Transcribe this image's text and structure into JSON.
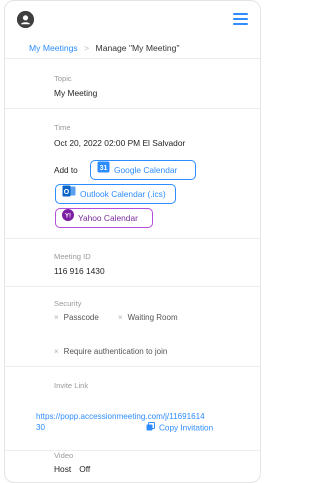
{
  "header": {
    "logo_icon": "user-circle-icon",
    "menu_icon": "hamburger-menu-icon",
    "accent": "#2d8cff"
  },
  "breadcrumb": {
    "parent": "My Meetings",
    "separator": ">",
    "current": "Manage \"My Meeting\""
  },
  "topic": {
    "label": "Topic",
    "value": "My Meeting"
  },
  "time": {
    "label": "Time",
    "value": "Oct 20, 2022 02:00 PM El Salvador",
    "add_to_label": "Add to",
    "google": {
      "label": "Google Calendar",
      "icon_text": "31"
    },
    "outlook": {
      "label": "Outlook Calendar (.ics)",
      "icon_text": "O"
    },
    "yahoo": {
      "label": "Yahoo Calendar",
      "icon_text": "Y!",
      "color": "#b44cd9"
    }
  },
  "meeting_id": {
    "label": "Meeting ID",
    "value": "116 916 1430"
  },
  "security": {
    "label": "Security",
    "options": [
      "Passcode",
      "Waiting Room",
      "Require authentication to join"
    ],
    "mark": "×"
  },
  "invite": {
    "label": "Invite Link",
    "url_line1": "https://popp.accessionmeeting.com/j/11691614",
    "url_line2": "30",
    "copy_label": "Copy Invitation"
  },
  "video": {
    "label": "Video",
    "host_label": "Host",
    "host_value": "Off"
  }
}
